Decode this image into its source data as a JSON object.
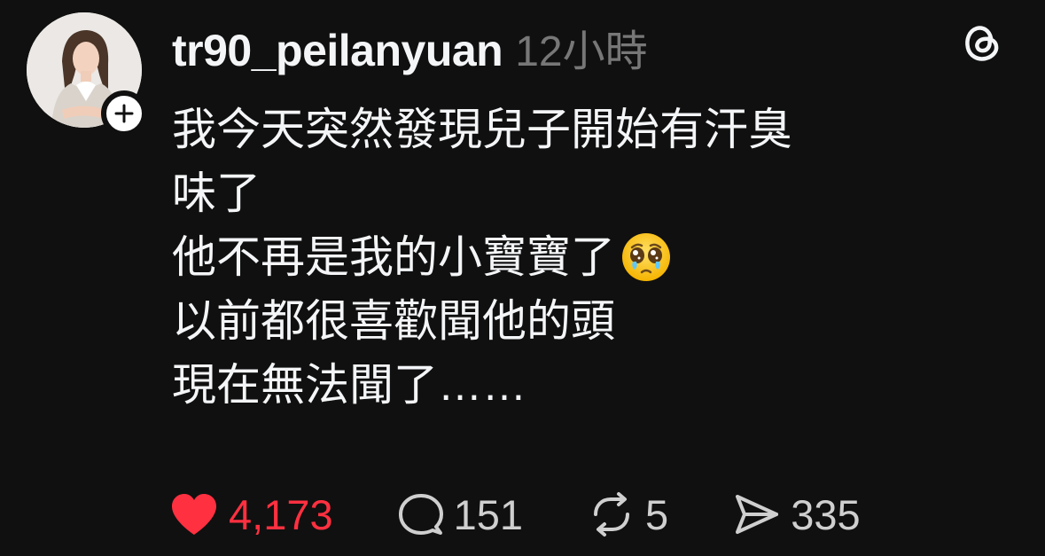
{
  "post": {
    "author": {
      "username": "tr90_peilanyuan",
      "avatar_icon": "profile-photo"
    },
    "timestamp": "12小時",
    "app_icon": "threads-logo-icon",
    "lines": [
      "我今天突然發現兒子開始有汗臭",
      "味了",
      "他不再是我的小寶寶了",
      "以前都很喜歡聞他的頭",
      "現在無法聞了……"
    ],
    "line3_emoji": "pleading-face-with-tears-emoji",
    "actions": {
      "likes": "4,173",
      "comments": "151",
      "reposts": "5",
      "shares": "335"
    }
  },
  "colors": {
    "background": "#101010",
    "text": "#f3f5f7",
    "muted": "#777777",
    "like": "#ff3040",
    "action": "#cfcfcf"
  }
}
